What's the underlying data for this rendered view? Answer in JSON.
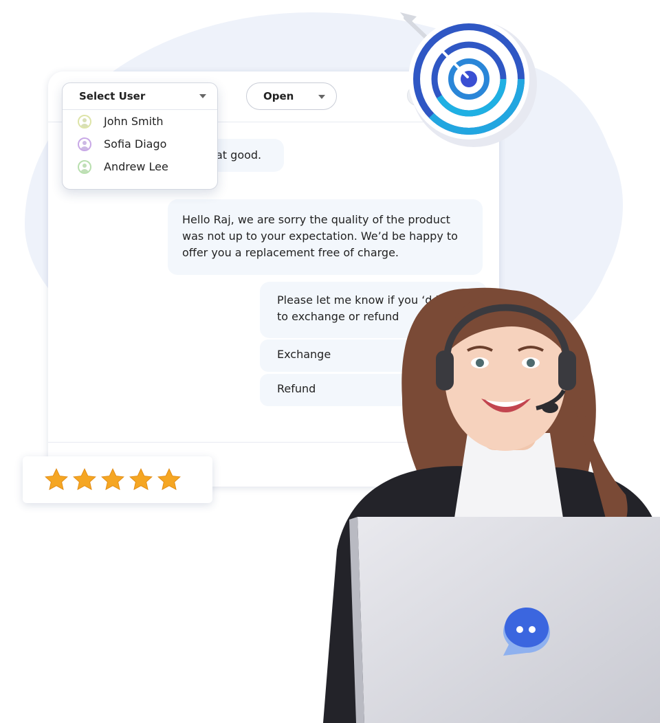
{
  "header": {
    "select_user_label": "Select User",
    "status_label": "Open"
  },
  "users": [
    {
      "name": "John Smith",
      "color": "#dde4a7"
    },
    {
      "name": "Sofia Diago",
      "color": "#c8a8e6"
    },
    {
      "name": "Andrew Lee",
      "color": "#b8dfae"
    }
  ],
  "messages": {
    "customer_partial": "at good.",
    "agent_reply": "Hello Raj, we are sorry the quality of the product was not up to your expectation. We’d be happy to offer you a replacement free of charge.",
    "agent_prompt_line1": "Please let me know if you ‘d like",
    "agent_prompt_line2": "to exchange or refund"
  },
  "options": {
    "exchange": "Exchange",
    "refund": "Refund"
  },
  "rating": {
    "stars": 5,
    "max": 5,
    "star_color": "#f5a623"
  },
  "icons": {
    "target": "target-icon",
    "chat_logo": "chat-bubble-icon"
  },
  "colors": {
    "accent_blue": "#3a5fd9",
    "bubble_bg": "#f3f7fc"
  }
}
